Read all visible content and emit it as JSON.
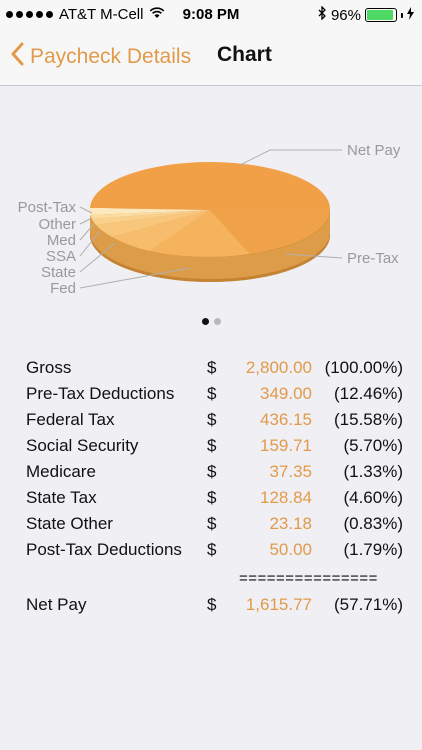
{
  "status_bar": {
    "carrier": "AT&T M-Cell",
    "time": "9:08 PM",
    "battery": "96%",
    "battery_level": 0.96
  },
  "nav": {
    "back_label": "Paycheck Details",
    "title": "Chart"
  },
  "pie_labels": {
    "net_pay": "Net Pay",
    "pre_tax": "Pre-Tax",
    "post_tax": "Post-Tax",
    "other": "Other",
    "med": "Med",
    "ssa": "SSA",
    "state": "State",
    "fed": "Fed"
  },
  "rows": [
    {
      "label": "Gross",
      "dollar": "$",
      "amount": "2,800.00",
      "percent": "(100.00%)"
    },
    {
      "label": "Pre-Tax Deductions",
      "dollar": "$",
      "amount": "349.00",
      "percent": "(12.46%)"
    },
    {
      "label": "Federal Tax",
      "dollar": "$",
      "amount": "436.15",
      "percent": "(15.58%)"
    },
    {
      "label": "Social Security",
      "dollar": "$",
      "amount": "159.71",
      "percent": "(5.70%)"
    },
    {
      "label": "Medicare",
      "dollar": "$",
      "amount": "37.35",
      "percent": "(1.33%)"
    },
    {
      "label": "State Tax",
      "dollar": "$",
      "amount": "128.84",
      "percent": "(4.60%)"
    },
    {
      "label": "State Other",
      "dollar": "$",
      "amount": "23.18",
      "percent": "(0.83%)"
    },
    {
      "label": "Post-Tax Deductions",
      "dollar": "$",
      "amount": "50.00",
      "percent": "(1.79%)"
    }
  ],
  "separator": "===============",
  "net_row": {
    "label": "Net Pay",
    "dollar": "$",
    "amount": "1,615.77",
    "percent": "(57.71%)"
  },
  "pager": {
    "count": 2,
    "active": 0
  },
  "colors": {
    "accent": "#e29a4a",
    "pie_top": "#f2a048",
    "pie_side": "#c97a2a",
    "label_gray": "#9a9a9a"
  }
}
